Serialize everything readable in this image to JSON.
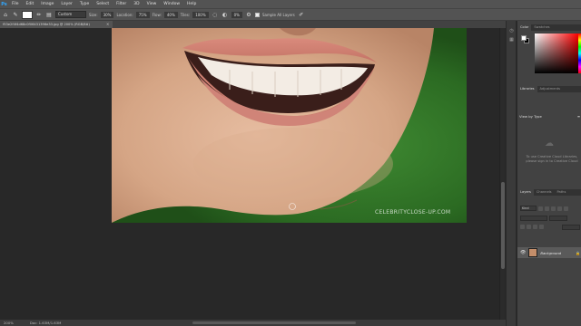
{
  "menubar": {
    "app_logo": "Ps",
    "items": [
      "File",
      "Edit",
      "Image",
      "Layer",
      "Type",
      "Select",
      "Filter",
      "3D",
      "View",
      "Window",
      "Help"
    ]
  },
  "options": {
    "mode_value": "Custom",
    "size_label": "Size:",
    "size_value": "30%",
    "location_label": "Location:",
    "location_value": "75%",
    "mode2_label": "Flow:",
    "mode2_value": "40%",
    "flow_label": "Tiles:",
    "flow_value": "100%",
    "angle_value": "0%",
    "sample_all_layers": "Sample All Layers"
  },
  "document": {
    "tab_title": "f53e2f4f4d68c0f06431396e33.jpg @ 200% (RGB/8#)",
    "watermark": "CELEBRITYCLOSE-UP.COM"
  },
  "status": {
    "zoom": "200%",
    "doc_size": "Doc: 1.63M/1.63M"
  },
  "color_panel": {
    "tabs": [
      "Color",
      "Swatches"
    ],
    "fg": "#ffffff",
    "bg": "#000000"
  },
  "libraries_panel": {
    "tabs": [
      "Libraries",
      "Adjustments"
    ],
    "view_by": "View by Type",
    "message": "To use Creative Cloud Libraries, please sign in to Creative Cloud"
  },
  "layers_panel": {
    "tabs": [
      "Layers",
      "Channels",
      "Paths"
    ],
    "kind": "Kind",
    "layer_name": "Background"
  },
  "colors": {
    "ui_dark": "#282828",
    "ui_mid": "#535353",
    "accent": "#31a8ff"
  }
}
